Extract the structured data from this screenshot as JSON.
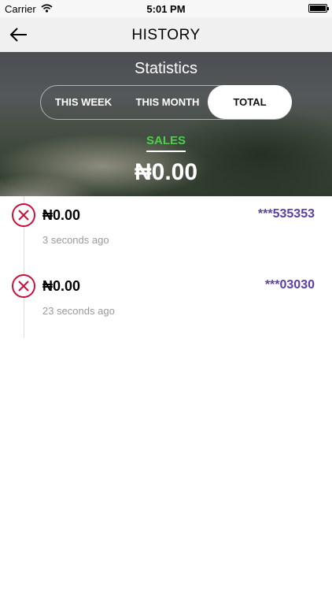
{
  "status_bar": {
    "carrier": "Carrier",
    "time": "5:01 PM",
    "wifi_icon": "wifi-icon",
    "battery_icon": "battery-icon"
  },
  "nav": {
    "title": "HISTORY",
    "back_icon": "arrow-left-icon"
  },
  "statistics": {
    "title": "Statistics",
    "tabs": [
      {
        "label": "THIS WEEK",
        "selected": false
      },
      {
        "label": "THIS MONTH",
        "selected": false
      },
      {
        "label": "TOTAL",
        "selected": true
      }
    ],
    "sales_label": "SALES",
    "sales_amount": "₦0.00"
  },
  "history": [
    {
      "amount": "₦0.00",
      "account": "***535353",
      "time": "3 seconds ago",
      "status_icon": "failed-x-icon"
    },
    {
      "amount": "₦0.00",
      "account": "***03030",
      "time": "23 seconds ago",
      "status_icon": "failed-x-icon"
    }
  ],
  "colors": {
    "sales_green": "#4bd04b",
    "account_purple": "#5b3fa6",
    "failed_red": "#c8103a"
  }
}
